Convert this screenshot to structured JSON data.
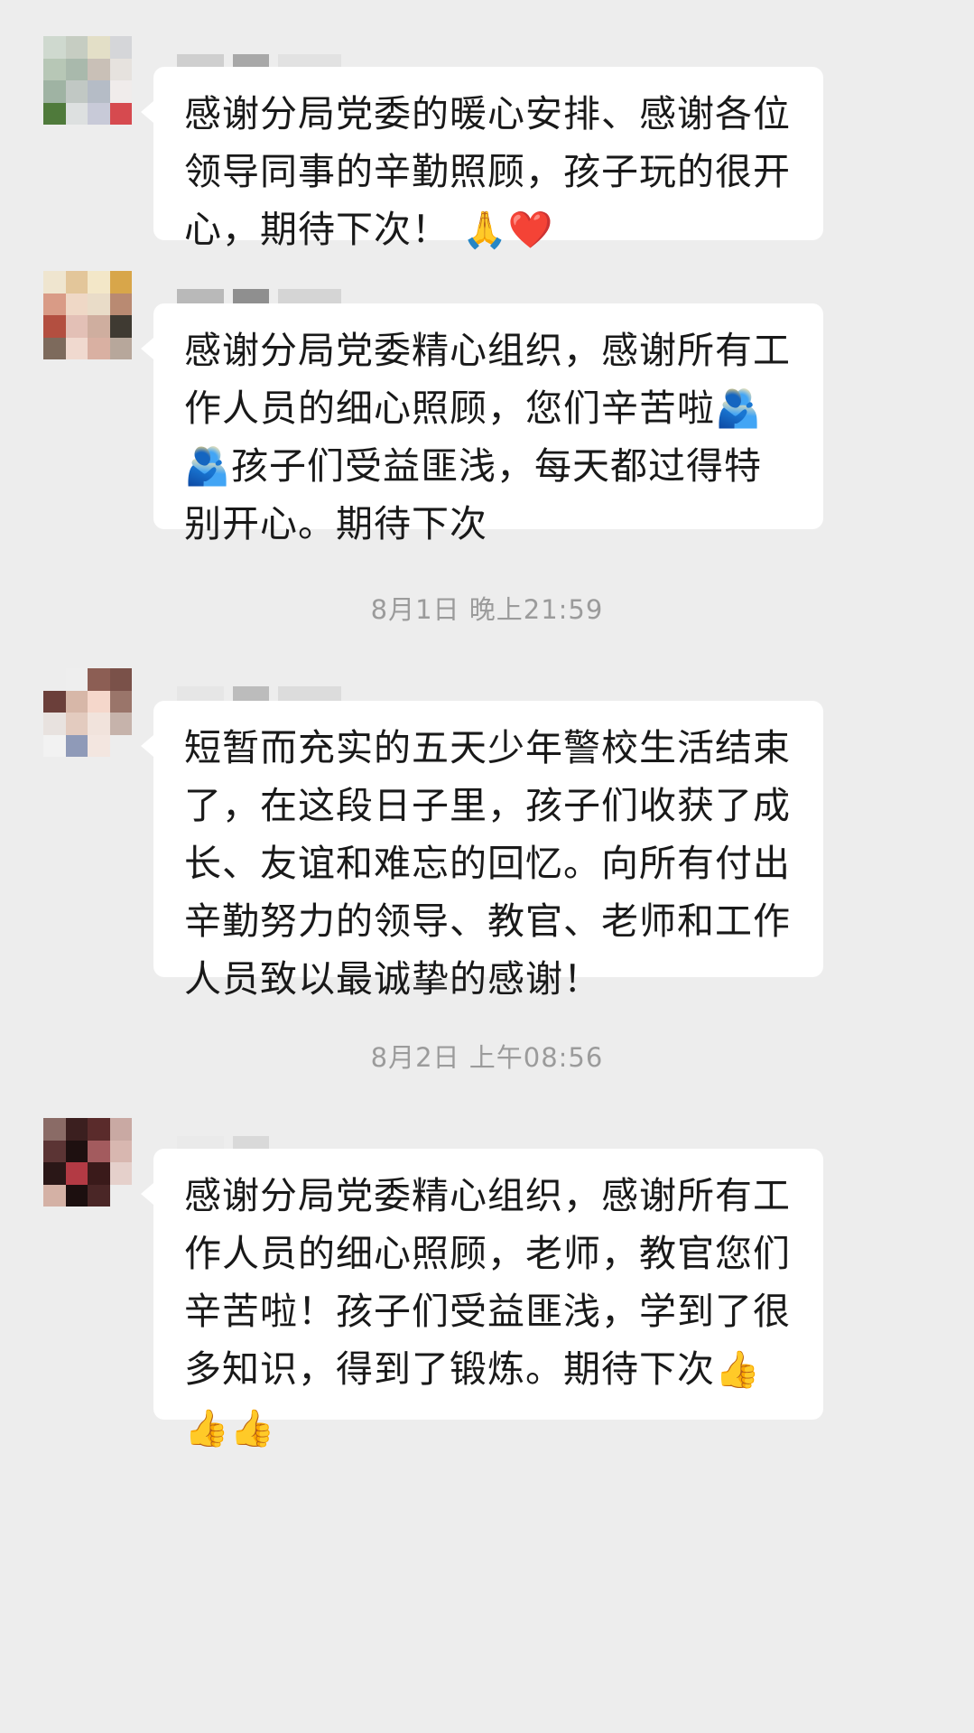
{
  "messages": [
    {
      "text": "感谢分局党委的暖心安排、感谢各位领导同事的辛勤照顾，孩子玩的很开心，期待下次！",
      "emoji": "🙏❤️",
      "avatar_colors": [
        "#cfd9cf",
        "#c6cdc2",
        "#e3dfc7",
        "#d5d6d9",
        "#b7c7b6",
        "#a9b9ac",
        "#c9c0b7",
        "#e6e2de",
        "#9fb3a3",
        "#c1c8c4",
        "#b5bcc6",
        "#f0eceb",
        "#4f7a3b",
        "#dde0e0",
        "#c8cad8",
        "#d64a4f"
      ],
      "name_blur_colors": [
        "#cfcfcf",
        "#a8a8a8",
        "#e2e2e2"
      ]
    },
    {
      "text": "感谢分局党委精心组织，感谢所有工作人员的细心照顾，您们辛苦啦🫂🫂孩子们受益匪浅，每天都过得特别开心。期待下次",
      "avatar_colors": [
        "#efe5cf",
        "#e3c69a",
        "#f3e7c8",
        "#d8a64a",
        "#d99b86",
        "#efd8c6",
        "#e9dcc8",
        "#b98a72",
        "#b34f40",
        "#e3c0b6",
        "#cfae9f",
        "#3f3a32",
        "#7d6a5c",
        "#f0d9cf",
        "#d9b0a2",
        "#b7a79b"
      ],
      "name_blur_colors": [
        "#b9b9b9",
        "#8f8f8f",
        "#d5d5d5"
      ]
    },
    {
      "text": "短暂而充实的五天少年警校生活结束了，在这段日子里，孩子们收获了成长、友谊和难忘的回忆。向所有付出辛勤努力的领导、教官、老师和工作人员致以最诚挚的感谢！",
      "avatar_colors": [
        "#ededed",
        "#eeeeee",
        "#8c5e54",
        "#7a5149",
        "#6b3f3a",
        "#d7b7a8",
        "#f5d7cb",
        "#9a756a",
        "#e8e2df",
        "#e3cbbf",
        "#f1e3dc",
        "#c6b3ab",
        "#f2f2f2",
        "#8f9ab8",
        "#f3e6e0",
        "#ededed"
      ],
      "name_blur_colors": [
        "#e6e6e6",
        "#bcbcbc",
        "#dcdcdc"
      ]
    },
    {
      "text": "感谢分局党委精心组织，感谢所有工作人员的细心照顾，老师，教官您们辛苦啦！孩子们受益匪浅，学到了很多知识，得到了锻炼。期待下次",
      "emoji": "👍👍👍",
      "avatar_colors": [
        "#8a6b66",
        "#3b1f1f",
        "#5a2b2b",
        "#c9a9a3",
        "#5b3434",
        "#1e1010",
        "#a35b5e",
        "#d8b7b0",
        "#2a1717",
        "#b33a44",
        "#3a1a1a",
        "#e5d0cb",
        "#d4b1a5",
        "#1c0f0f",
        "#4a2626",
        "#ededed"
      ],
      "name_blur_colors": [
        "#eaeaea",
        "#d9d9d9",
        "#ededed"
      ]
    }
  ],
  "timestamps": [
    "8月1日 晚上21:59",
    "8月2日 上午08:56"
  ]
}
